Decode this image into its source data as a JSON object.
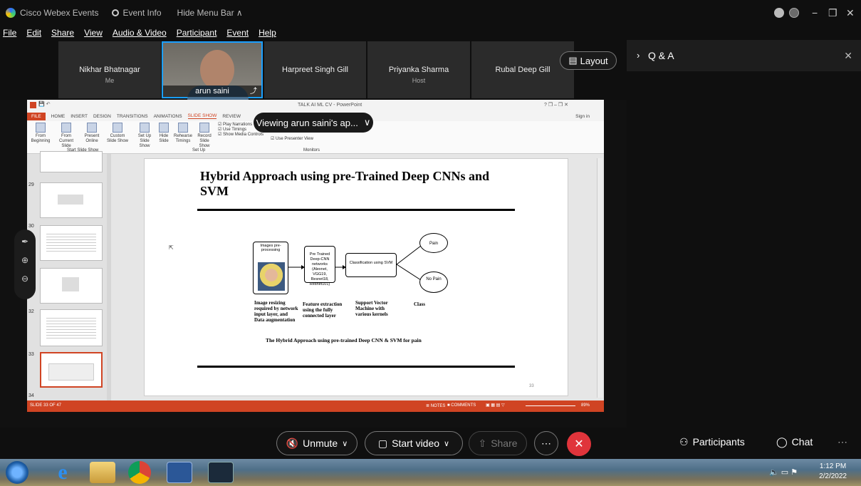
{
  "titlebar": {
    "app_name": "Cisco Webex Events",
    "event_info": "Event Info",
    "hide_menu": "Hide Menu Bar ∧",
    "min": "−",
    "max": "❐",
    "close": "✕"
  },
  "menu": [
    "File",
    "Edit",
    "Share",
    "View",
    "Audio & Video",
    "Participant",
    "Event",
    "Help"
  ],
  "participants": [
    {
      "name": "Nikhar Bhatnagar",
      "role": "Me"
    },
    {
      "name": "arun saini",
      "role": ""
    },
    {
      "name": "Harpreet Singh Gill",
      "role": ""
    },
    {
      "name": "Priyanka Sharma",
      "role": "Host"
    },
    {
      "name": "Rubal Deep Gill",
      "role": ""
    }
  ],
  "layout_label": "Layout",
  "qa": {
    "label": "Q & A",
    "close": "✕"
  },
  "viewing_banner": "Viewing arun saini's ap...",
  "ppt": {
    "window_title": "TALK AI ML CV - PowerPoint",
    "sign_in": "Sign in",
    "tabs": [
      "FILE",
      "HOME",
      "INSERT",
      "DESIGN",
      "TRANSITIONS",
      "ANIMATIONS",
      "SLIDE SHOW",
      "REVIEW"
    ],
    "ribbon": [
      "From Beginning",
      "From Current Slide",
      "Present Online",
      "Custom Slide Show",
      "Set Up Slide Show",
      "Hide Slide",
      "Rehearse Timings",
      "Record Slide Show"
    ],
    "ribbon_checks": [
      "Play Narrations",
      "Use Timings",
      "Show Media Controls"
    ],
    "presenter_view": "Use Presenter View",
    "groups": [
      "Start Slide Show",
      "Set Up",
      "Monitors"
    ],
    "thumb_numbers": [
      "29",
      "30",
      "31",
      "32",
      "33",
      "34"
    ],
    "status_left": "SLIDE 33 OF 47",
    "status_notes": "NOTES",
    "status_comments": "COMMENTS",
    "zoom": "89%",
    "slide": {
      "title": "Hybrid Approach using pre-Trained Deep CNNs and SVM",
      "box1": "Images pre-processing",
      "box2": "Pre Trained Deep-CNN networks (Alexnet, VGG19, Resnet18, Resnet101)",
      "box3": "Classification using SVM",
      "pain": "Pain",
      "no_pain": "No Pain",
      "cap1": "Image resizing required by network input layer, and Data augmentation",
      "cap2": "Feature extraction using the fully connected layer",
      "cap3": "Support Vector Machine with various kernels",
      "cap4": "Class",
      "caption": "The Hybrid Approach using pre-trained Deep CNN & SVM for pain",
      "page": "33"
    }
  },
  "controls": {
    "unmute": "Unmute",
    "start_video": "Start video",
    "share": "Share",
    "more": "⋯",
    "end": "✕",
    "participants": "Participants",
    "chat": "Chat",
    "overflow": "⋯"
  },
  "clock": {
    "time": "1:12 PM",
    "date": "2/2/2022"
  }
}
